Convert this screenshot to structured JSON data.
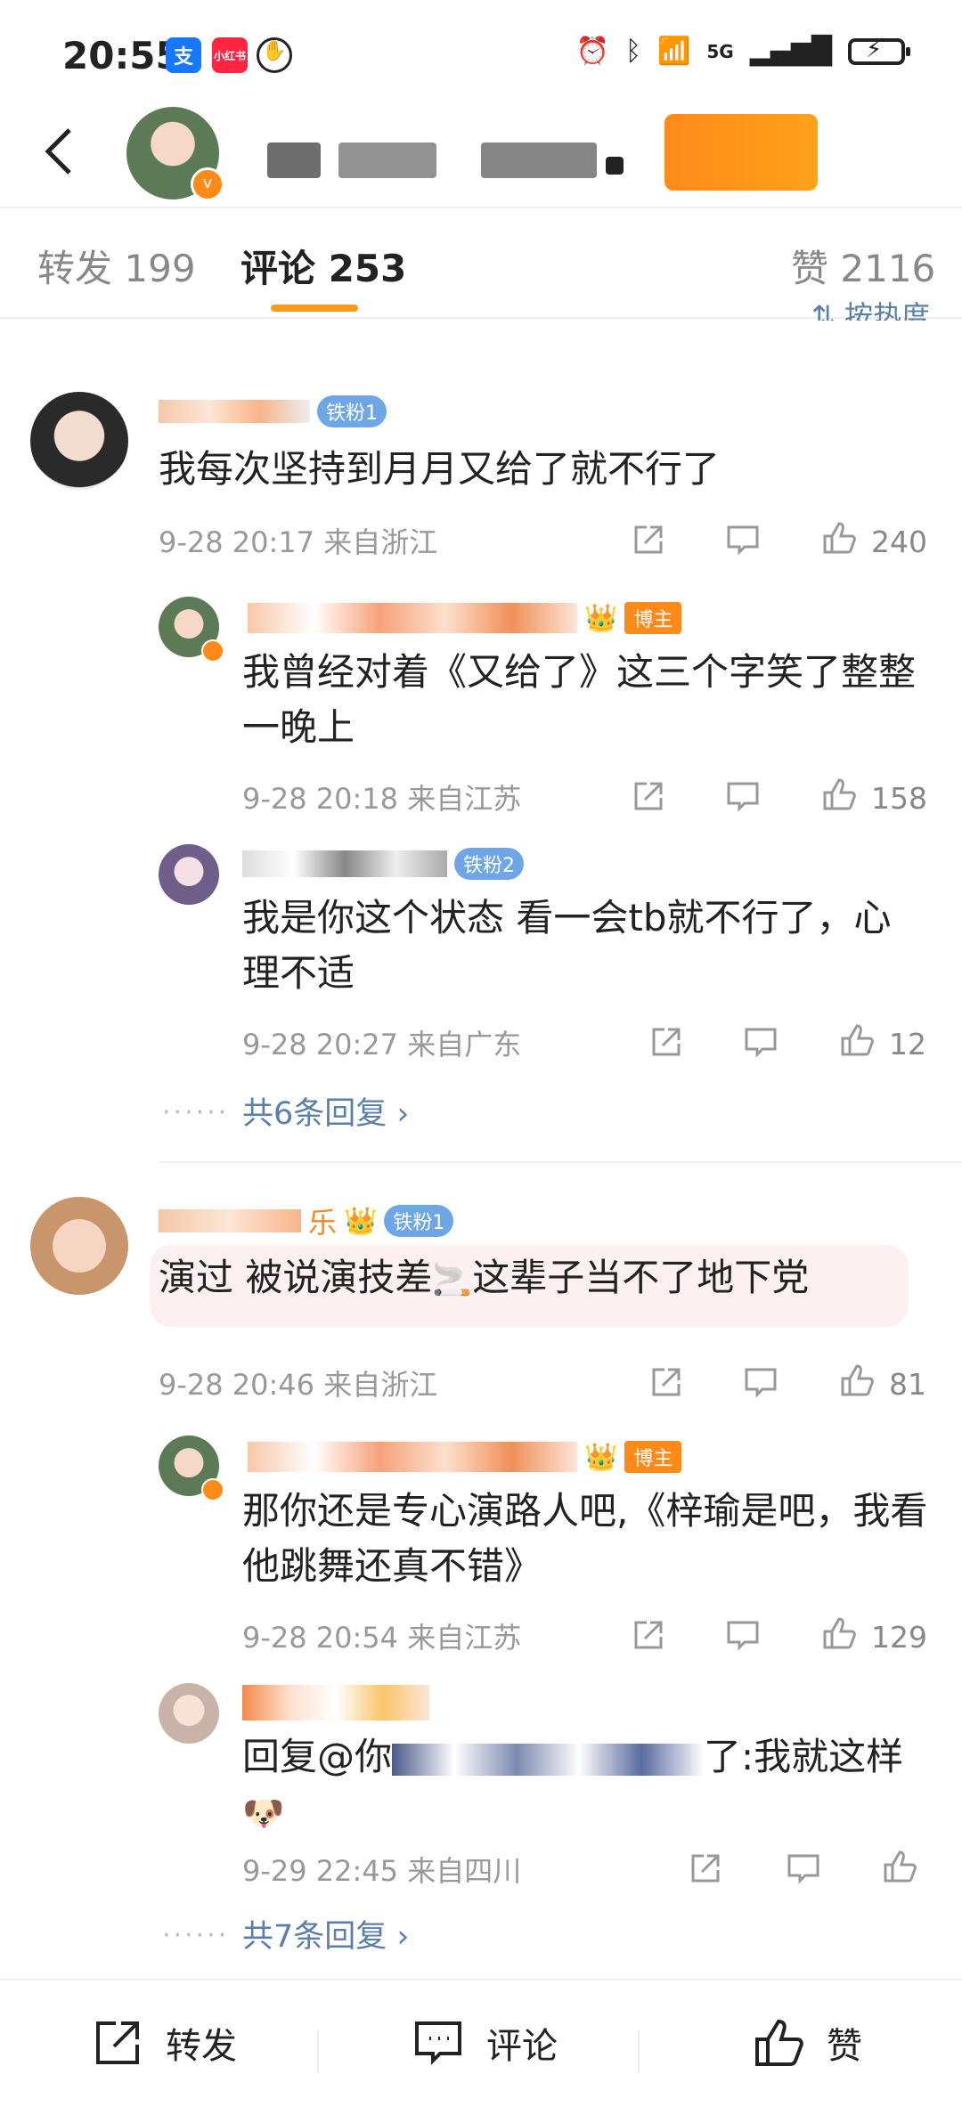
{
  "status_bar": {
    "time": "20:55",
    "app1": "支",
    "app2": "小红书",
    "network": "5G"
  },
  "tabs": [
    {
      "label": "转发",
      "count": "199"
    },
    {
      "label": "评论",
      "count": "253"
    },
    {
      "label": "赞",
      "count": "2116"
    }
  ],
  "sort_label": "按热度",
  "comments": [
    {
      "badge": "铁粉1",
      "text": "我每次坚持到月月又给了就不行了",
      "meta": "9-28 20:17  来自浙江",
      "likes": "240"
    },
    {
      "badge": "博主",
      "text": "我曾经对着《又给了》这三个字笑了整整一晚上",
      "meta": "9-28 20:18  来自江苏",
      "likes": "158"
    },
    {
      "badge": "铁粉2",
      "text": "我是你这个状态 看一会tb就不行了，心理不适",
      "meta": "9-28 20:27  来自广东",
      "likes": "12"
    },
    {
      "more": "共6条回复"
    },
    {
      "name_suffix": "乐",
      "badge": "铁粉1",
      "text_a": "演过 被说演技差",
      "text_b": "这辈子当不了地下党",
      "meta": "9-28 20:46  来自浙江",
      "likes": "81"
    },
    {
      "badge": "博主",
      "text": "那你还是专心演路人吧,《梓瑜是吧，我看他跳舞还真不错》",
      "meta": "9-28 20:54  来自江苏",
      "likes": "129"
    },
    {
      "text_a": "回复@你",
      "text_b": "了:我就这样",
      "meta": "9-29 22:45  来自四川",
      "likes": ""
    },
    {
      "more": "共7条回复"
    }
  ],
  "bottom_bar": {
    "repost": "转发",
    "comment": "评论",
    "like": "赞"
  },
  "colors": {
    "accent": "#ff9a1a",
    "link": "#5b7fa8"
  }
}
